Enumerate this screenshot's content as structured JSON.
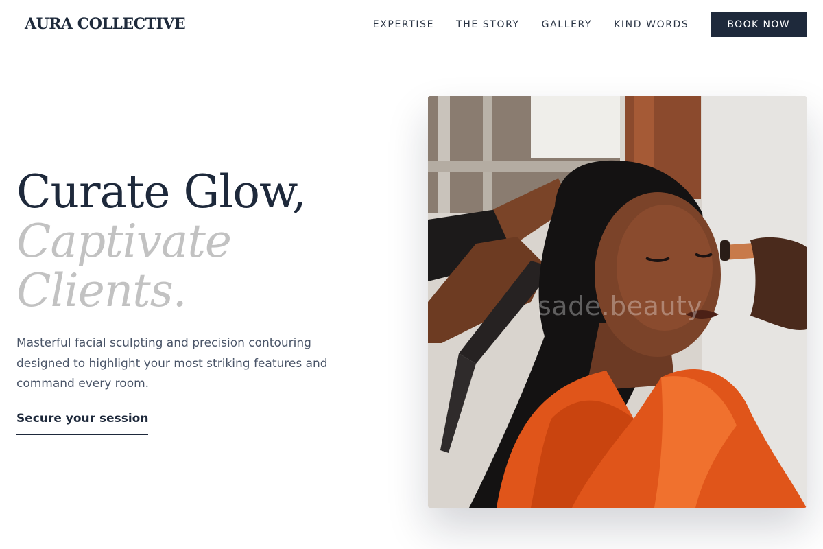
{
  "brand": {
    "name": "AURA COLLECTIVE"
  },
  "nav": {
    "items": [
      {
        "label": "EXPERTISE"
      },
      {
        "label": "THE STORY"
      },
      {
        "label": "GALLERY"
      },
      {
        "label": "KIND WORDS"
      }
    ],
    "cta_label": "BOOK NOW"
  },
  "hero": {
    "heading_line_1": "Curate Glow,",
    "heading_line_2": "Captivate",
    "heading_line_3": "Clients.",
    "description": "Masterful facial sculpting and precision contouring designed to highlight your most striking features and command every room.",
    "link_label": "Secure your session",
    "image": {
      "description": "photo-makeup-artist-and-stylist-working-on-client",
      "watermark": "sade.beauty"
    }
  },
  "colors": {
    "navy": "#1e293b",
    "muted_gray": "#c2c2c2",
    "body_text": "#4a5568",
    "white": "#ffffff",
    "robe_orange": "#e0551a"
  }
}
